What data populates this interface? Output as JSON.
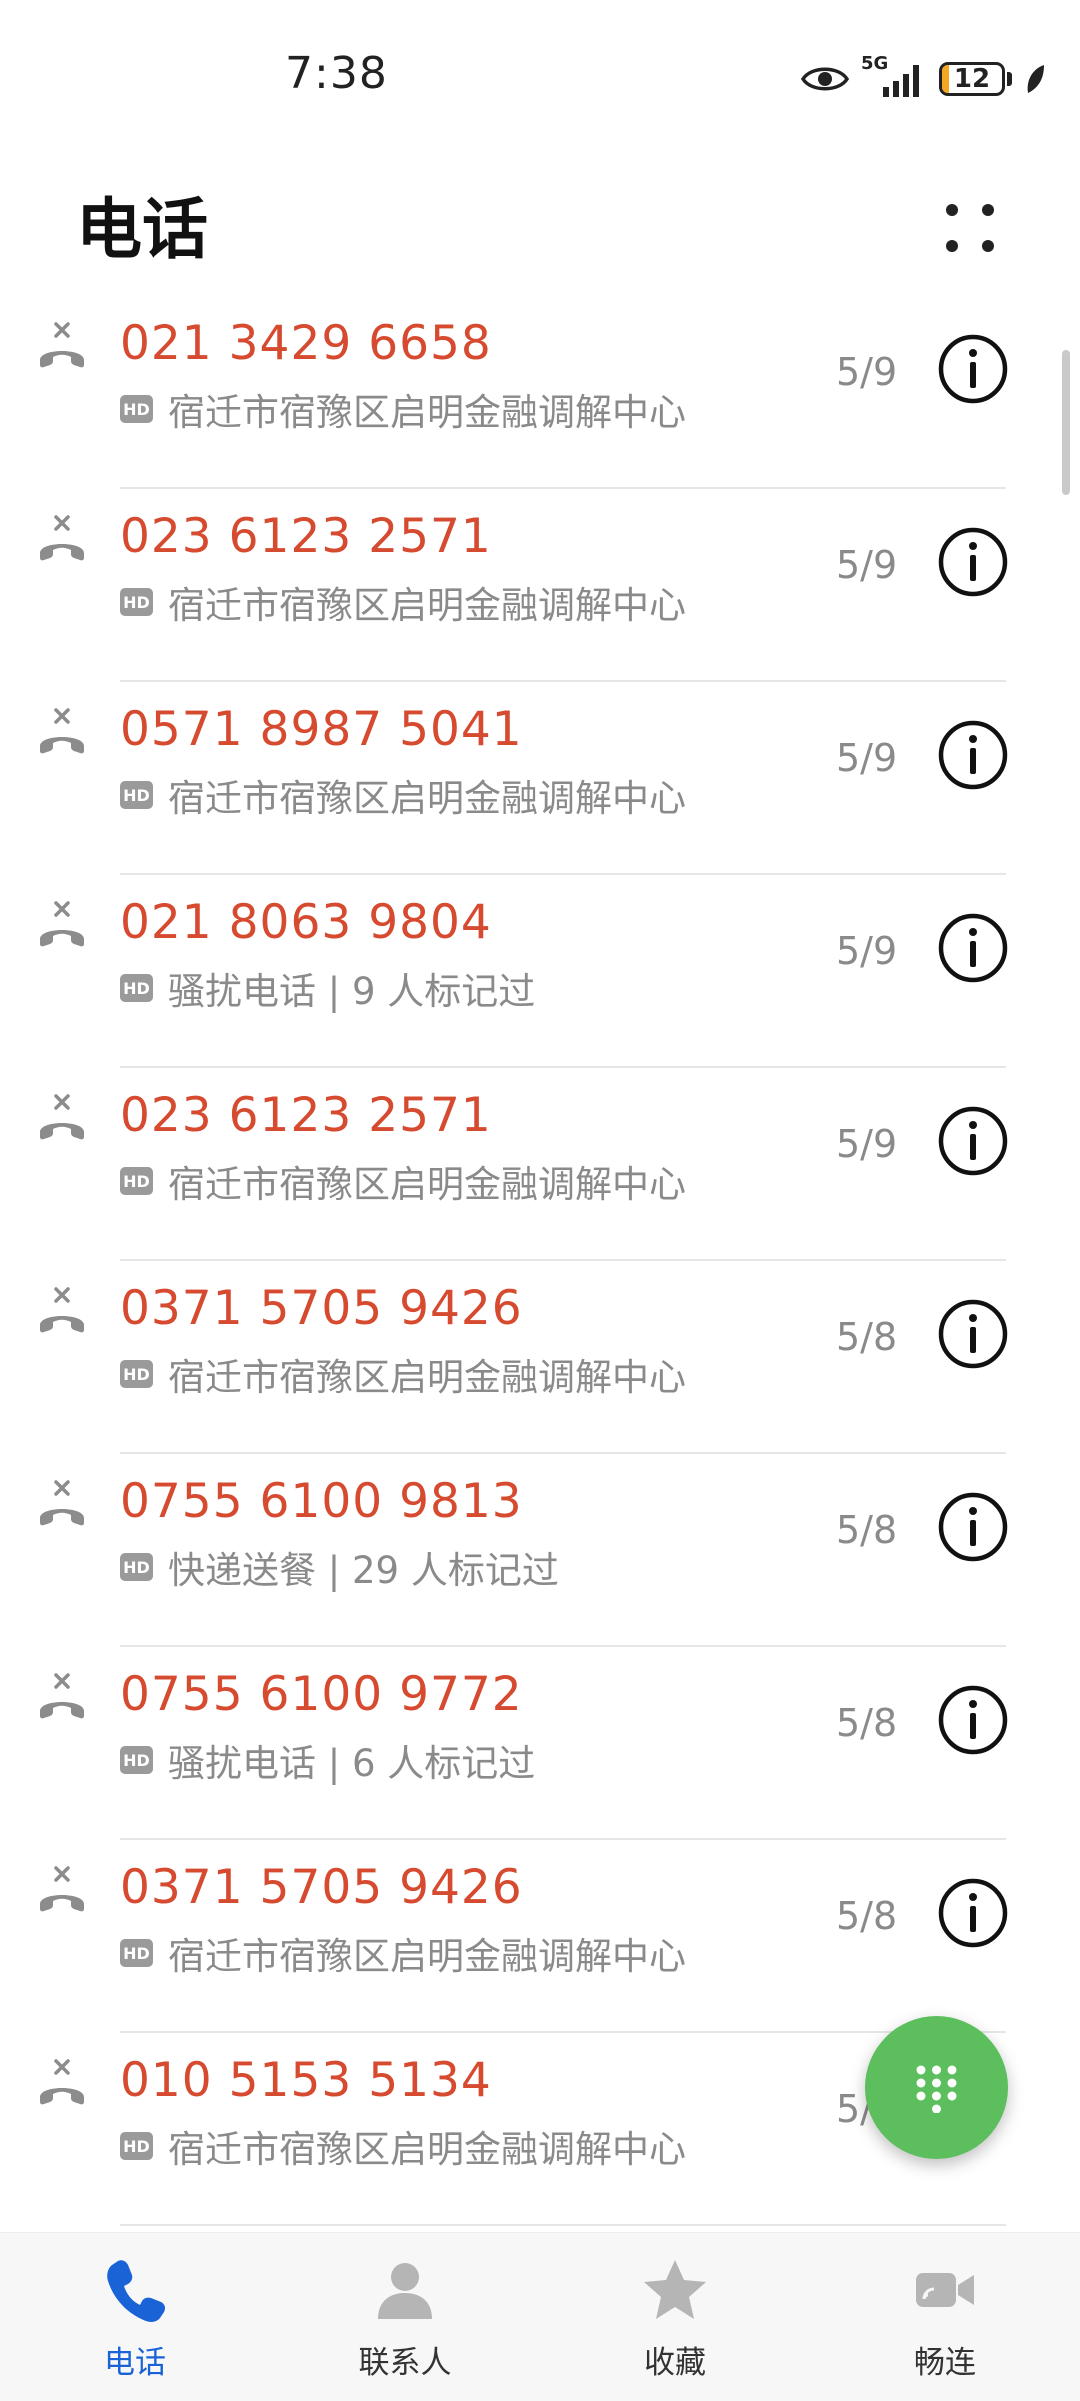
{
  "status_bar": {
    "time": "7:38",
    "network": "5G",
    "battery_level": "12",
    "battery_fraction": 0.12,
    "icons": [
      "eye-icon",
      "signal-icon",
      "battery-icon",
      "leaf-icon"
    ]
  },
  "header": {
    "title": "电话",
    "more_icon": "four-dots-icon"
  },
  "calls": [
    {
      "number": "021 3429 6658",
      "label": "宿迁市宿豫区启明金融调解中心",
      "date": "5/9"
    },
    {
      "number": "023 6123 2571",
      "label": "宿迁市宿豫区启明金融调解中心",
      "date": "5/9"
    },
    {
      "number": "0571 8987 5041",
      "label": "宿迁市宿豫区启明金融调解中心",
      "date": "5/9"
    },
    {
      "number": "021 8063 9804",
      "label": "骚扰电话 | 9 人标记过",
      "date": "5/9"
    },
    {
      "number": "023 6123 2571",
      "label": "宿迁市宿豫区启明金融调解中心",
      "date": "5/9"
    },
    {
      "number": "0371 5705 9426",
      "label": "宿迁市宿豫区启明金融调解中心",
      "date": "5/8"
    },
    {
      "number": "0755 6100 9813",
      "label": "快递送餐 | 29 人标记过",
      "date": "5/8"
    },
    {
      "number": "0755 6100 9772",
      "label": "骚扰电话 | 6 人标记过",
      "date": "5/8"
    },
    {
      "number": "0371 5705 9426",
      "label": "宿迁市宿豫区启明金融调解中心",
      "date": "5/8"
    },
    {
      "number": "010 5153 5134",
      "label": "宿迁市宿豫区启明金融调解中心",
      "date": "5/8"
    }
  ],
  "hd_badge": "HD",
  "colors": {
    "missed_number": "#d64a2f",
    "fab": "#5cbe5c",
    "nav_active": "#1a63d6"
  },
  "nav": [
    {
      "label": "电话",
      "icon": "phone-icon",
      "active": true
    },
    {
      "label": "联系人",
      "icon": "person-icon",
      "active": false
    },
    {
      "label": "收藏",
      "icon": "star-icon",
      "active": false
    },
    {
      "label": "畅连",
      "icon": "video-call-icon",
      "active": false
    }
  ]
}
